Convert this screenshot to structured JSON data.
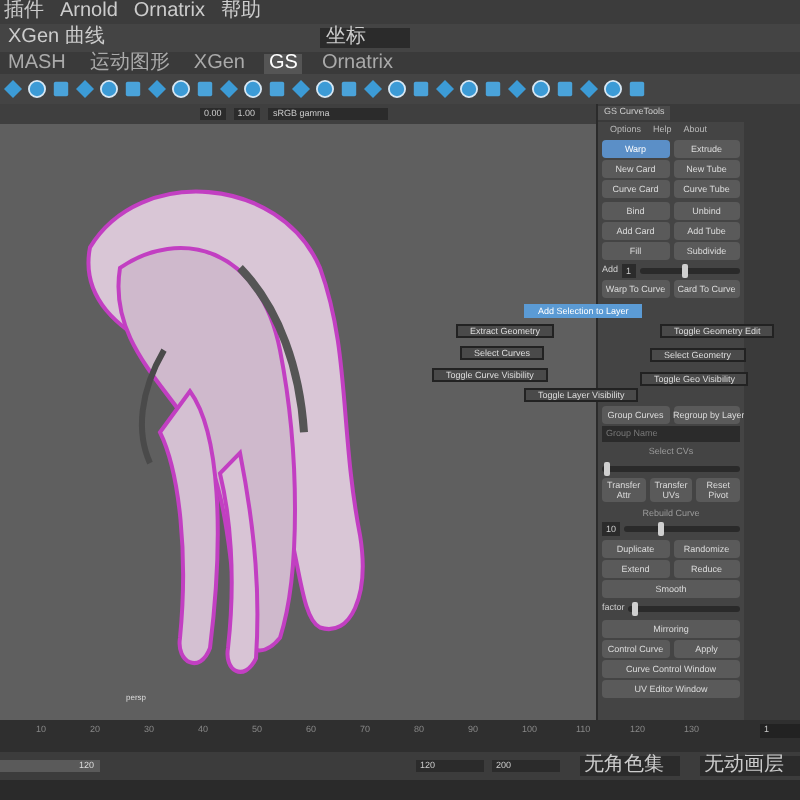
{
  "menu_bar": {
    "items": [
      "插件",
      "Arnold",
      "Ornatrix",
      "帮助"
    ]
  },
  "toolbar": {
    "mode": "XGen 曲线",
    "workspace": "坐标"
  },
  "shelf": {
    "tabs": [
      {
        "label": "MASH",
        "selected": false
      },
      {
        "label": "运动图形",
        "selected": false
      },
      {
        "label": "XGen",
        "selected": false
      },
      {
        "label": "GS",
        "selected": true
      },
      {
        "label": "Ornatrix",
        "selected": false
      }
    ]
  },
  "viewport": {
    "exposure": "0.00",
    "gamma": "1.00",
    "color_space": "sRGB gamma",
    "camera": "persp"
  },
  "marking_menu": [
    {
      "label": "Add Selection to Layer",
      "selected": true
    },
    {
      "label": "Extract Geometry",
      "selected": false
    },
    {
      "label": "Select Curves",
      "selected": false
    },
    {
      "label": "Toggle Curve Visibility",
      "selected": false
    },
    {
      "label": "Toggle Layer Visibility",
      "selected": false
    },
    {
      "label": "Toggle Geometry Edit",
      "selected": false
    },
    {
      "label": "Select Geometry",
      "selected": false
    },
    {
      "label": "Toggle Geo Visibility",
      "selected": false
    }
  ],
  "curve_tools": {
    "title": "GS CurveTools",
    "menu": [
      "Options",
      "Help",
      "About"
    ],
    "rows": [
      {
        "kind": "buttons",
        "buttons": [
          {
            "label": "Warp",
            "selected": true
          },
          {
            "label": "Extrude",
            "selected": false
          }
        ]
      },
      {
        "kind": "buttons",
        "buttons": [
          {
            "label": "New Card",
            "selected": false
          },
          {
            "label": "New Tube",
            "selected": false
          }
        ]
      },
      {
        "kind": "buttons",
        "buttons": [
          {
            "label": "Curve Card",
            "selected": false
          },
          {
            "label": "Curve Tube",
            "selected": false
          }
        ]
      },
      {
        "kind": "buttons",
        "buttons": [
          {
            "label": "Bind",
            "selected": false
          },
          {
            "label": "Unbind",
            "selected": false
          }
        ]
      },
      {
        "kind": "buttons",
        "buttons": [
          {
            "label": "Add Card",
            "selected": false
          },
          {
            "label": "Add Tube",
            "selected": false
          }
        ]
      },
      {
        "kind": "buttons",
        "buttons": [
          {
            "label": "Fill",
            "selected": false
          },
          {
            "label": "Subdivide",
            "selected": false
          }
        ]
      },
      {
        "kind": "slider",
        "label": "Add",
        "value": "1",
        "level": 0.45
      },
      {
        "kind": "buttons",
        "buttons": [
          {
            "label": "Warp To Curve",
            "selected": false
          },
          {
            "label": "Card To Curve",
            "selected": false
          }
        ]
      },
      {
        "kind": "gap"
      },
      {
        "kind": "buttons",
        "buttons": [
          {
            "label": "Group Curves",
            "selected": false
          },
          {
            "label": "Regroup by Layer",
            "selected": false
          }
        ]
      },
      {
        "kind": "field",
        "placeholder": "Group Name"
      },
      {
        "kind": "label",
        "label": "Select CVs"
      },
      {
        "kind": "slider",
        "level": 0.02
      },
      {
        "kind": "buttons",
        "buttons": [
          {
            "label": "Transfer Attr",
            "selected": false
          },
          {
            "label": "Transfer UVs",
            "selected": false
          },
          {
            "label": "Reset Pivot",
            "selected": false
          }
        ]
      },
      {
        "kind": "label",
        "label": "Rebuild Curve"
      },
      {
        "kind": "slider",
        "value": "10",
        "level": 0.3
      },
      {
        "kind": "buttons",
        "buttons": [
          {
            "label": "Duplicate",
            "selected": false
          },
          {
            "label": "Randomize",
            "selected": false
          }
        ]
      },
      {
        "kind": "buttons",
        "buttons": [
          {
            "label": "Extend",
            "selected": false
          },
          {
            "label": "Reduce",
            "selected": false
          }
        ]
      },
      {
        "kind": "buttons",
        "buttons": [
          {
            "label": "Smooth",
            "selected": false
          }
        ]
      },
      {
        "kind": "slider",
        "label": "factor",
        "level": 0.03
      },
      {
        "kind": "buttons",
        "buttons": [
          {
            "label": "Mirroring",
            "selected": false
          }
        ]
      },
      {
        "kind": "buttons",
        "buttons": [
          {
            "label": "Control Curve",
            "selected": false
          },
          {
            "label": "Apply",
            "selected": false
          }
        ]
      },
      {
        "kind": "buttons",
        "buttons": [
          {
            "label": "Curve Control Window",
            "selected": false
          }
        ]
      },
      {
        "kind": "buttons",
        "buttons": [
          {
            "label": "UV Editor Window",
            "selected": false
          }
        ]
      }
    ]
  },
  "time_slider": {
    "ticks": [
      "10",
      "20",
      "30",
      "40",
      "50",
      "60",
      "70",
      "80",
      "90",
      "100",
      "110",
      "120",
      "130"
    ],
    "current": "1"
  },
  "range_slider": {
    "end": "120",
    "playback_end": "120",
    "animation_end": "200",
    "character_set": "无角色集",
    "anim_layer": "无动画层"
  }
}
